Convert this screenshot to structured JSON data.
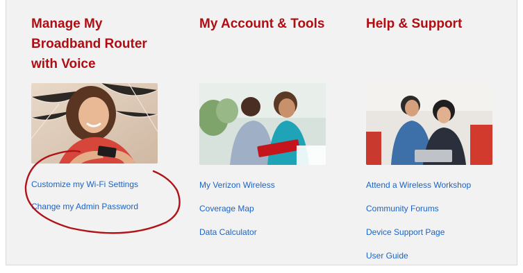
{
  "columns": [
    {
      "heading_lines": [
        "Manage My",
        "Broadband Router",
        "with Voice"
      ],
      "photo_icon": "woman-with-phone-photo",
      "links": [
        "Customize my Wi-Fi Settings",
        "Change my Admin Password"
      ]
    },
    {
      "heading_lines": [
        "My Account & Tools"
      ],
      "photo_icon": "couple-with-tablet-photo",
      "links": [
        "My Verizon Wireless",
        "Coverage Map",
        "Data Calculator"
      ]
    },
    {
      "heading_lines": [
        "Help & Support"
      ],
      "photo_icon": "couple-at-laptop-photo",
      "links": [
        "Attend a Wireless Workshop",
        "Community Forums",
        "Device Support Page",
        "User Guide"
      ]
    }
  ],
  "colors": {
    "heading": "#b00d12",
    "link": "#1a63c5",
    "panel_background": "#f2f2f2",
    "highlight_oval": "#b01218"
  }
}
